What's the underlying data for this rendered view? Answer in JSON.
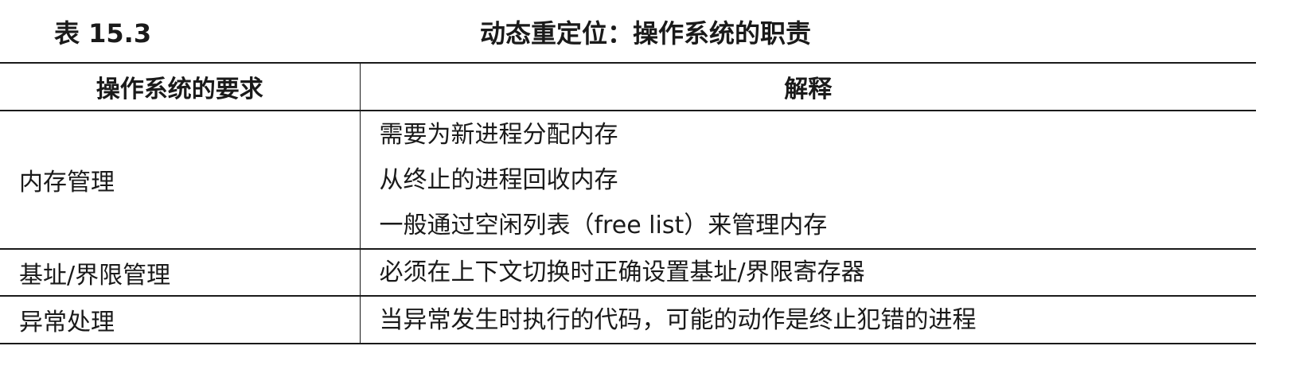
{
  "caption": {
    "number": "表 15.3",
    "title": "动态重定位：操作系统的职责"
  },
  "table": {
    "headers": [
      "操作系统的要求",
      "解释"
    ],
    "rows": [
      {
        "requirement": "内存管理",
        "explanation": [
          "需要为新进程分配内存",
          "从终止的进程回收内存",
          "一般通过空闲列表（free list）来管理内存"
        ]
      },
      {
        "requirement": "基址/界限管理",
        "explanation": [
          "必须在上下文切换时正确设置基址/界限寄存器"
        ]
      },
      {
        "requirement": "异常处理",
        "explanation": [
          "当异常发生时执行的代码，可能的动作是终止犯错的进程"
        ]
      }
    ]
  }
}
